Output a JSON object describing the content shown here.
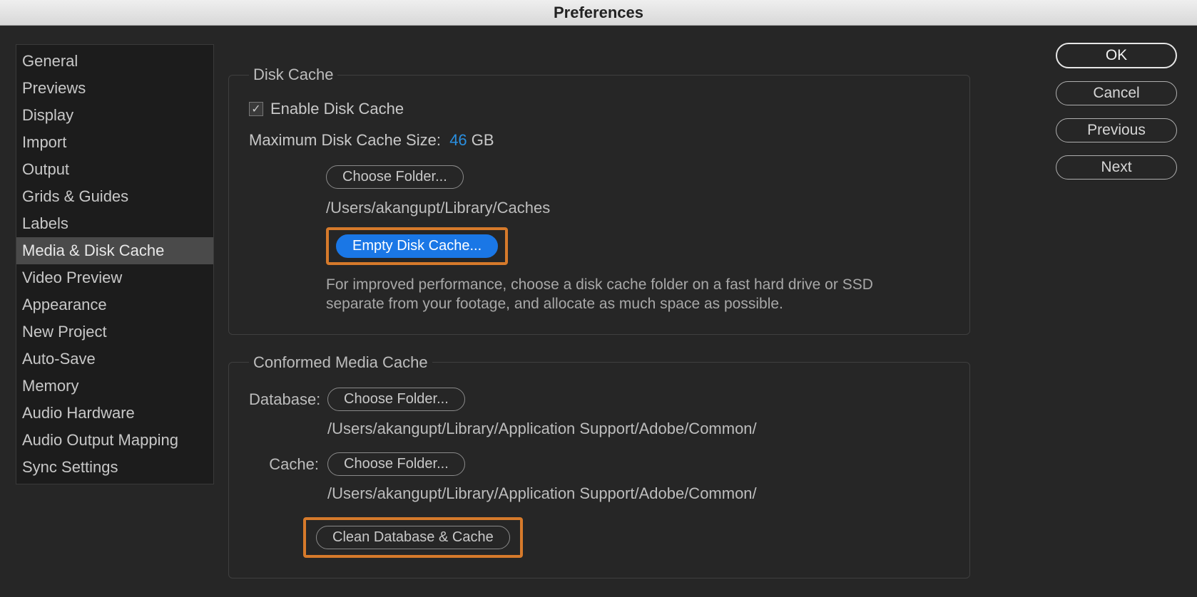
{
  "window": {
    "title": "Preferences"
  },
  "sidebar": {
    "items": [
      {
        "label": "General"
      },
      {
        "label": "Previews"
      },
      {
        "label": "Display"
      },
      {
        "label": "Import"
      },
      {
        "label": "Output"
      },
      {
        "label": "Grids & Guides"
      },
      {
        "label": "Labels"
      },
      {
        "label": "Media & Disk Cache"
      },
      {
        "label": "Video Preview"
      },
      {
        "label": "Appearance"
      },
      {
        "label": "New Project"
      },
      {
        "label": "Auto-Save"
      },
      {
        "label": "Memory"
      },
      {
        "label": "Audio Hardware"
      },
      {
        "label": "Audio Output Mapping"
      },
      {
        "label": "Sync Settings"
      }
    ],
    "selected_index": 7
  },
  "disk_cache": {
    "legend": "Disk Cache",
    "enable_label": "Enable Disk Cache",
    "enable_checked": true,
    "max_size_label": "Maximum Disk Cache Size:",
    "max_size_value": "46",
    "max_size_unit": "GB",
    "choose_folder_label": "Choose Folder...",
    "folder_path": "/Users/akangupt/Library/Caches",
    "empty_label": "Empty Disk Cache...",
    "help_text": "For improved performance, choose a disk cache folder on a fast hard drive or SSD separate from your footage, and allocate as much space as possible."
  },
  "conformed": {
    "legend": "Conformed Media Cache",
    "database_label": "Database:",
    "choose_folder_label": "Choose Folder...",
    "database_path": "/Users/akangupt/Library/Application Support/Adobe/Common/",
    "cache_label": "Cache:",
    "cache_path": "/Users/akangupt/Library/Application Support/Adobe/Common/",
    "clean_label": "Clean Database & Cache"
  },
  "actions": {
    "ok": "OK",
    "cancel": "Cancel",
    "previous": "Previous",
    "next": "Next"
  }
}
